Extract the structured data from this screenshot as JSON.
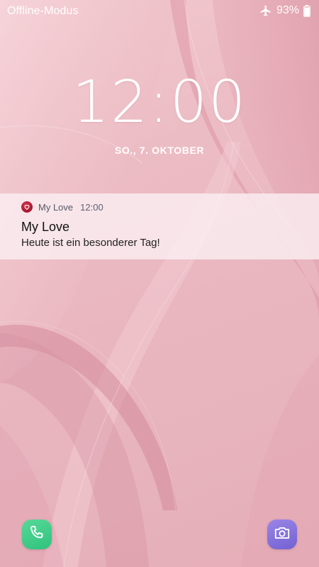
{
  "status_bar": {
    "network_status": "Offline-Modus",
    "battery_percent": "93%",
    "battery_level": 0.93,
    "icons": [
      "airplane-icon",
      "battery-icon"
    ]
  },
  "lockscreen": {
    "time": "12:00",
    "date": "SO., 7. OKTOBER"
  },
  "notification": {
    "app_name": "My Love",
    "time": "12:00",
    "title": "My Love",
    "text": "Heute ist ein besonderer Tag!",
    "app_icon": "heart-icon",
    "app_icon_color": "#b51f36"
  },
  "shortcuts": {
    "left": {
      "icon": "phone-icon",
      "color": "#3ecb87"
    },
    "right": {
      "icon": "camera-icon",
      "color": "#8674dd"
    }
  },
  "colors": {
    "wallpaper": "#ebbac3",
    "notification_background": "#faeef1"
  }
}
